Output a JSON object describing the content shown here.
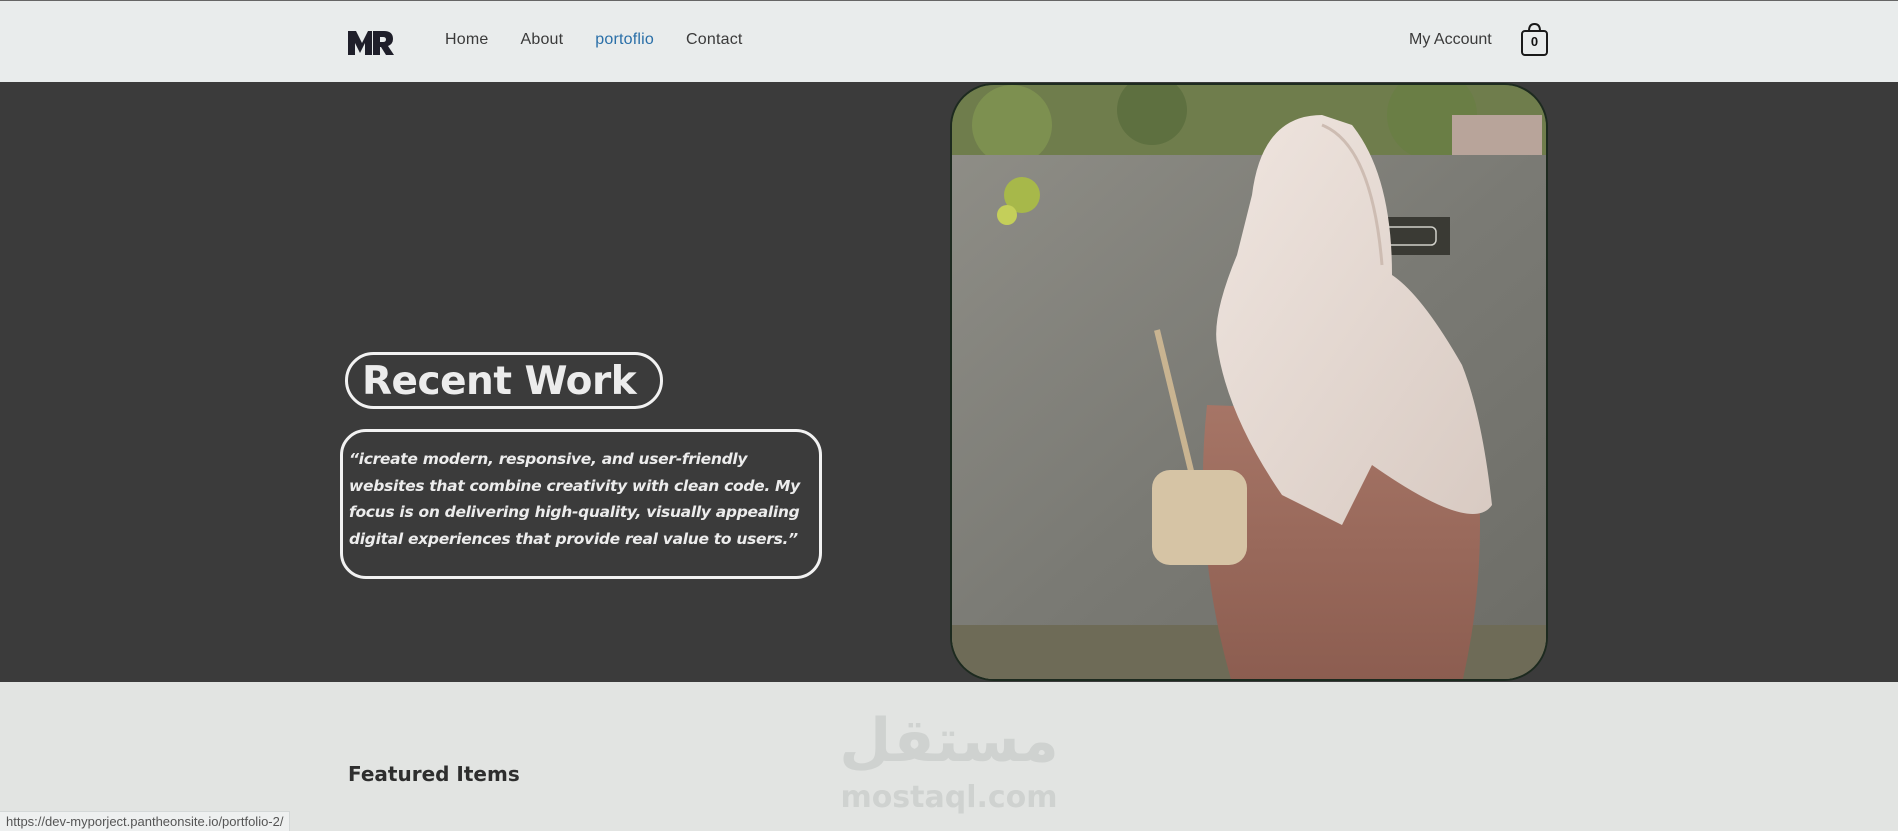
{
  "header": {
    "logo_text": "MR",
    "nav": [
      {
        "label": "Home"
      },
      {
        "label": "About"
      },
      {
        "label": "portoflio"
      },
      {
        "label": "Contact"
      }
    ],
    "account_label": "My Account",
    "cart_count": "0"
  },
  "hero": {
    "title": "Recent Work",
    "quote": "“icreate modern, responsive, and user-friendly websites that combine creativity with clean code. My focus is on delivering high-quality, visually appealing digital experiences that provide real value to users.”",
    "photo_icon": "woman-in-hijab-photo"
  },
  "featured": {
    "heading": "Featured Items"
  },
  "watermark": {
    "arabic": "مستقل",
    "latin": "mostaql.com"
  },
  "status_bar": {
    "url": "https://dev-myporject.pantheonsite.io/portfolio-2/"
  },
  "colors": {
    "header_bg": "#e9ecec",
    "hero_bg": "#3b3b3b",
    "active_nav": "#2a6fa8",
    "page_bg": "#e2e4e2"
  }
}
